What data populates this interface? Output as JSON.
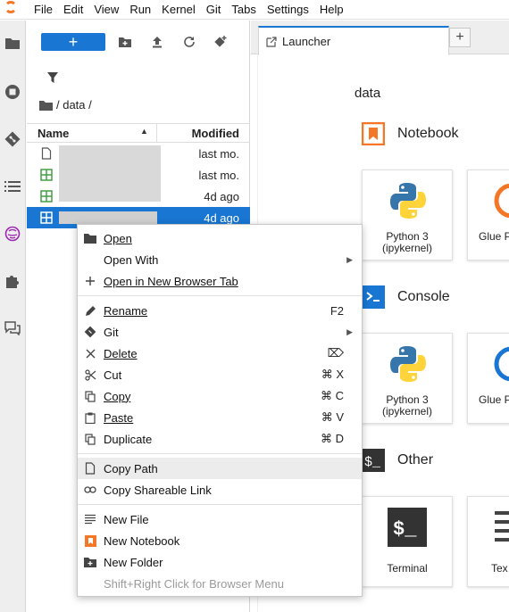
{
  "menubar": {
    "items": [
      "File",
      "Edit",
      "View",
      "Run",
      "Kernel",
      "Git",
      "Tabs",
      "Settings",
      "Help"
    ]
  },
  "activity_bar": {
    "icons": [
      "folder-icon",
      "running-icon",
      "git-icon",
      "toc-icon",
      "extension-icon",
      "puzzle-icon",
      "chat-icon"
    ]
  },
  "file_browser": {
    "new_label": "+",
    "breadcrumb": "/ data /",
    "columns": {
      "name": "Name",
      "modified": "Modified"
    },
    "rows": [
      {
        "type": "file",
        "modified": "last mo."
      },
      {
        "type": "spreadsheet",
        "modified": "last mo."
      },
      {
        "type": "spreadsheet",
        "modified": "4d ago"
      },
      {
        "type": "spreadsheet",
        "modified": "4d ago",
        "selected": true
      }
    ]
  },
  "tabs": {
    "active_label": "Launcher",
    "add_label": "+"
  },
  "launcher": {
    "directory": "data",
    "sections": {
      "notebook": "Notebook",
      "console": "Console",
      "other": "Other"
    },
    "cards": {
      "nb_python": "Python 3\n(ipykernel)",
      "nb_glue": "Glue P",
      "con_python": "Python 3\n(ipykernel)",
      "con_glue": "Glue P",
      "terminal": "Terminal",
      "text": "Tex"
    }
  },
  "context_menu": {
    "open": "Open",
    "open_with": "Open With",
    "open_new_tab": "Open in New Browser Tab",
    "rename": "Rename",
    "rename_shortcut": "F2",
    "git": "Git",
    "delete": "Delete",
    "delete_shortcut": "⌦",
    "cut": "Cut",
    "cut_shortcut": "⌘ X",
    "copy": "Copy",
    "copy_shortcut": "⌘ C",
    "paste": "Paste",
    "paste_shortcut": "⌘ V",
    "duplicate": "Duplicate",
    "duplicate_shortcut": "⌘ D",
    "copy_path": "Copy Path",
    "copy_shareable_link": "Copy Shareable Link",
    "new_file": "New File",
    "new_notebook": "New Notebook",
    "new_folder": "New Folder",
    "browser_menu_hint": "Shift+Right Click for Browser Menu"
  },
  "colors": {
    "accent": "#1976d2",
    "notebook_orange": "#f37726",
    "spreadsheet_green": "#43a047"
  }
}
